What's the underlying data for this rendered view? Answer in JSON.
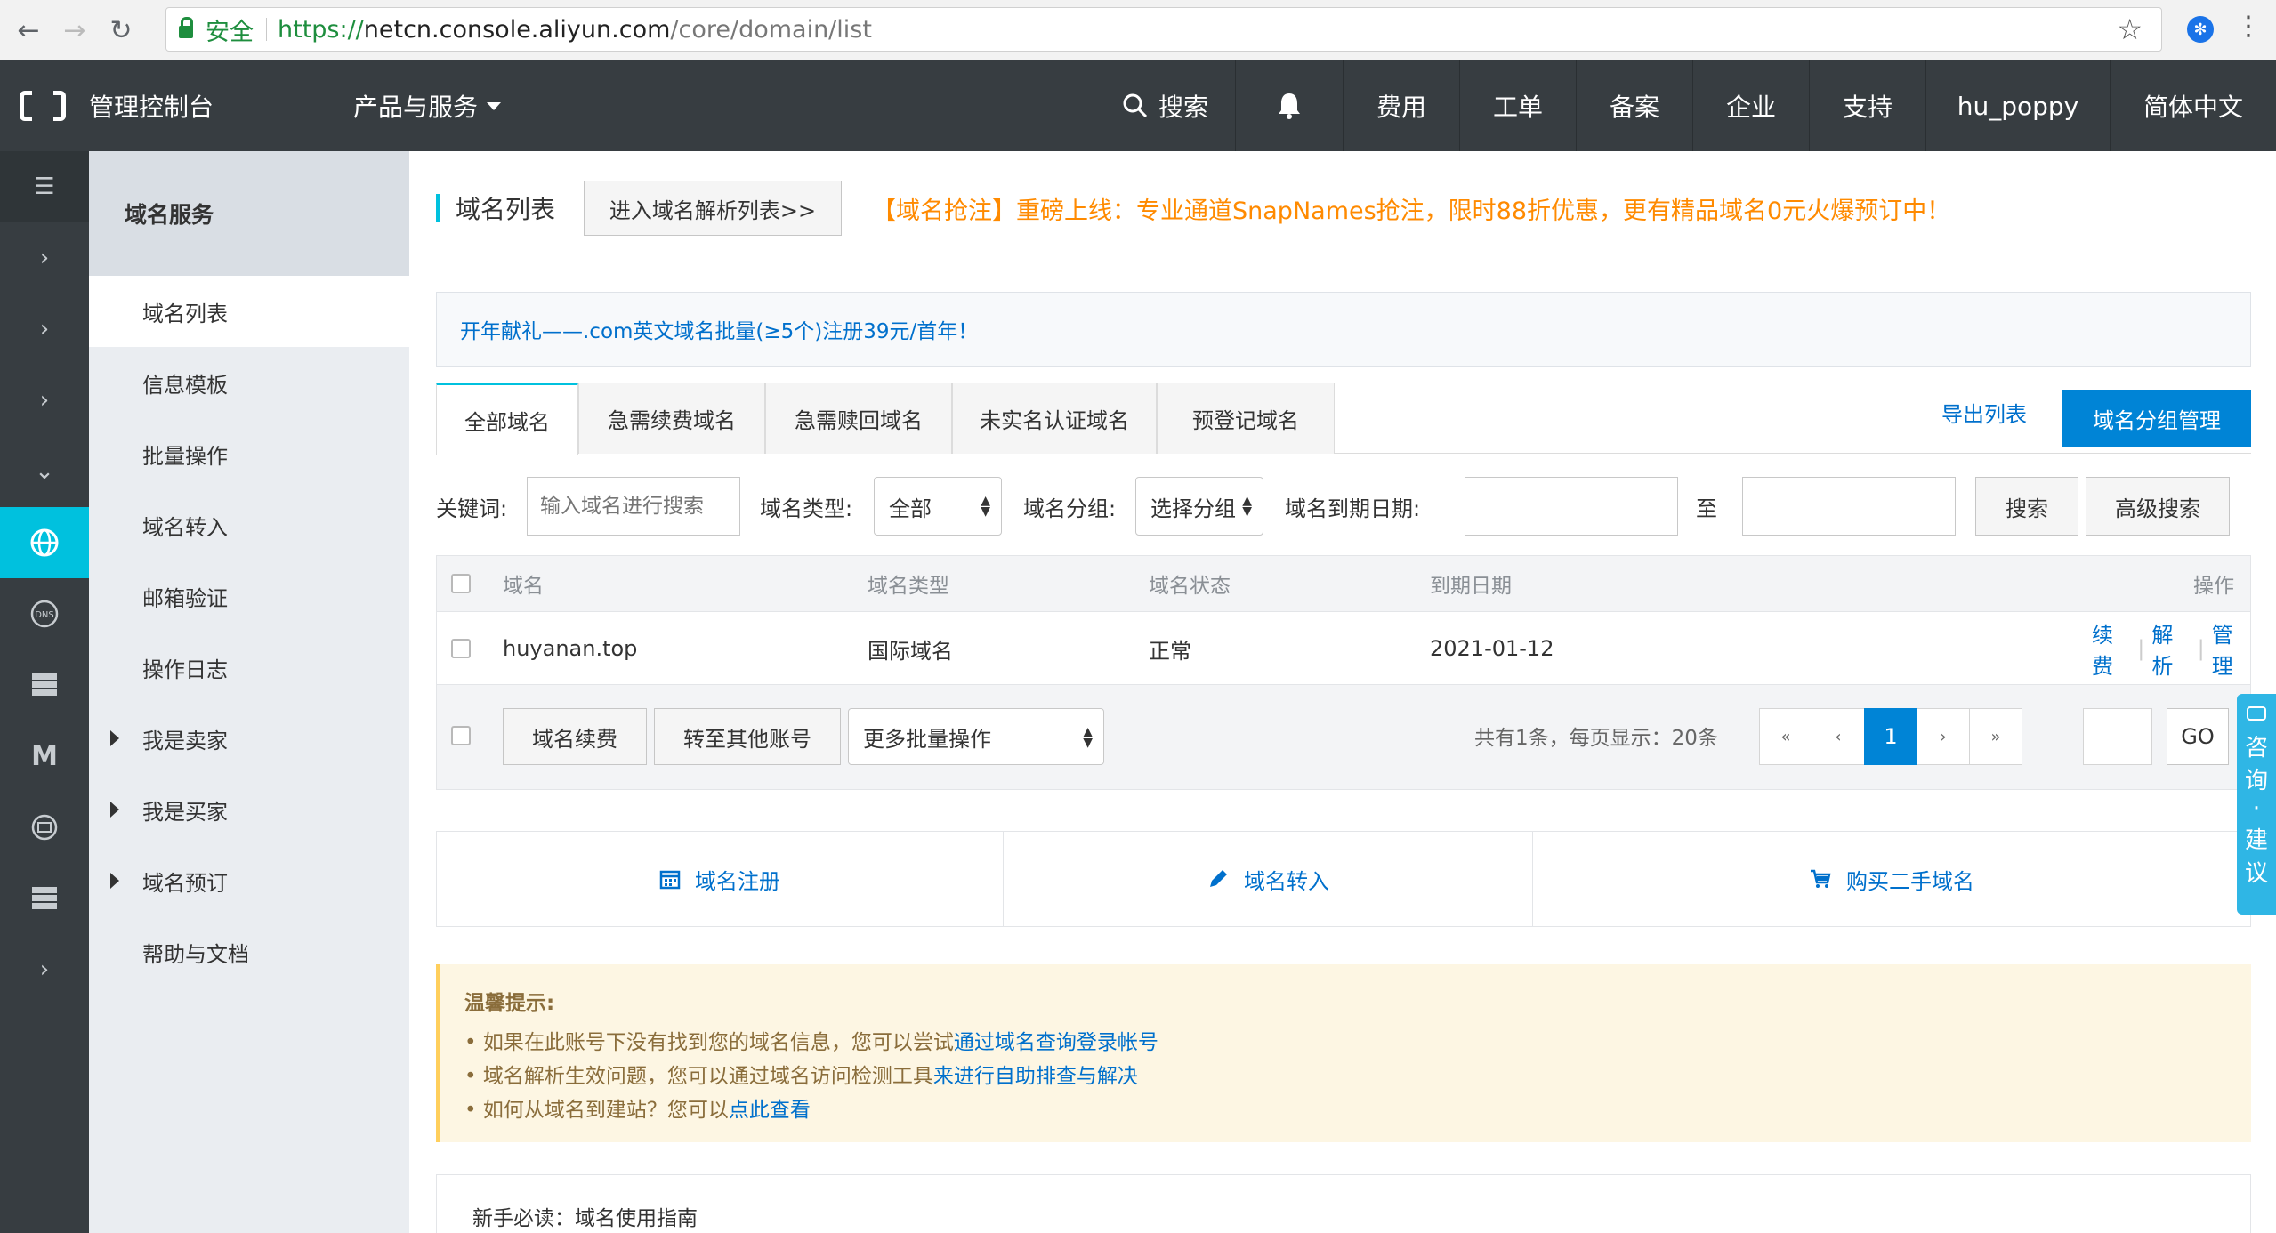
{
  "browser": {
    "secure_label": "安全",
    "url_scheme": "https://",
    "url_host": "netcn.console.aliyun.com",
    "url_path": "/core/domain/list"
  },
  "topbar": {
    "console": "管理控制台",
    "products": "产品与服务",
    "search": "搜索",
    "fees": "费用",
    "ticket": "工单",
    "icp": "备案",
    "enterprise": "企业",
    "support": "支持",
    "user": "hu_poppy",
    "language": "简体中文"
  },
  "rail": {
    "icons": [
      "menu-icon",
      "chevron-right-icon",
      "chevron-right-icon",
      "chevron-right-icon",
      "chevron-down-icon",
      "globe-icon",
      "dns-icon",
      "server-icon",
      "m-icon",
      "monitor-icon",
      "server-icon",
      "chevron-right-icon"
    ]
  },
  "sidebar": {
    "header": "域名服务",
    "items": [
      {
        "label": "域名列表",
        "active": true
      },
      {
        "label": "信息模板"
      },
      {
        "label": "批量操作"
      },
      {
        "label": "域名转入"
      },
      {
        "label": "邮箱验证"
      },
      {
        "label": "操作日志"
      },
      {
        "label": "我是卖家",
        "expandable": true
      },
      {
        "label": "我是买家",
        "expandable": true
      },
      {
        "label": "域名预订",
        "expandable": true
      },
      {
        "label": "帮助与文档"
      }
    ]
  },
  "header": {
    "title": "域名列表",
    "dns_button": "进入域名解析列表>>",
    "promo": "【域名抢注】重磅上线：专业通道SnapNames抢注，限时88折优惠，更有精品域名0元火爆预订中！"
  },
  "notice": "开年献礼——.com英文域名批量(≥5个)注册39元/首年！",
  "tabs": [
    "全部域名",
    "急需续费域名",
    "急需赎回域名",
    "未实名认证域名",
    "预登记域名"
  ],
  "actions": {
    "export": "导出列表",
    "group_manage": "域名分组管理"
  },
  "filters": {
    "keyword_label": "关键词:",
    "keyword_placeholder": "输入域名进行搜索",
    "type_label": "域名类型:",
    "type_value": "全部",
    "group_label": "域名分组:",
    "group_value": "选择分组",
    "expire_label": "域名到期日期:",
    "to_label": "至",
    "search": "搜索",
    "advanced": "高级搜索"
  },
  "table": {
    "columns": [
      "域名",
      "域名类型",
      "域名状态",
      "到期日期",
      "操作"
    ],
    "rows": [
      {
        "domain": "huyanan.top",
        "type": "国际域名",
        "status": "正常",
        "expires": "2021-01-12",
        "ops": [
          "续费",
          "解析",
          "管理"
        ]
      }
    ]
  },
  "footer": {
    "renew": "域名续费",
    "transfer_account": "转至其他账号",
    "more_batch": "更多批量操作",
    "summary": "共有1条，每页显示：20条",
    "first": "«",
    "prev": "‹",
    "current_page": "1",
    "next": "›",
    "last": "»",
    "go": "GO"
  },
  "quick_links": {
    "register": "域名注册",
    "transfer_in": "域名转入",
    "buy_second_hand": "购买二手域名"
  },
  "tips": {
    "title": "温馨提示:",
    "line1_text": "• 如果在此账号下没有找到您的域名信息，您可以尝试 ",
    "line1_link": "通过域名查询登录帐号",
    "line2_text": "• 域名解析生效问题，您可以通过域名访问检测工具 ",
    "line2_link": "来进行自助排查与解决",
    "line3_text": "• 如何从域名到建站？您可以",
    "line3_link": "点此查看"
  },
  "guide": "新手必读：域名使用指南",
  "consult": [
    "咨",
    "询",
    "·",
    "建",
    "议"
  ],
  "colors": {
    "topbar": "#373d41",
    "accent": "#00c1de",
    "primary": "#0084d6",
    "promo": "#ff8a00",
    "link": "#0070cc"
  }
}
